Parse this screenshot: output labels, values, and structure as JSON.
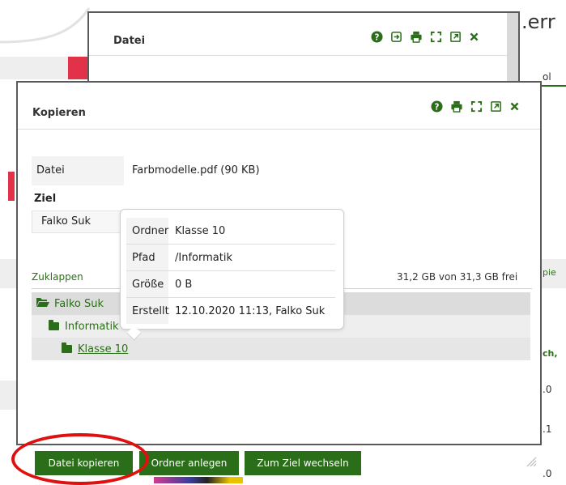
{
  "background": {
    "logo_fragment": ".err",
    "right_texts": [
      "ol",
      "pie",
      "ch,",
      ".0",
      ".1",
      ".0"
    ]
  },
  "back_dialog": {
    "title": "Datei",
    "icons": [
      "help-icon",
      "login-icon",
      "print-icon",
      "fullscreen-icon",
      "external-link-icon",
      "close-icon"
    ]
  },
  "copy_dialog": {
    "title": "Kopieren",
    "icons": [
      "help-icon",
      "print-icon",
      "fullscreen-icon",
      "external-link-icon",
      "close-icon"
    ],
    "file_label": "Datei",
    "file_value": "Farbmodelle.pdf (90 KB)",
    "target_label": "Ziel",
    "target_value": "Falko Suk",
    "collapse_link": "Zuklappen",
    "storage": "31,2 GB von 31,3 GB frei",
    "tree": [
      {
        "label": "Falko Suk"
      },
      {
        "label": "Informatik"
      },
      {
        "label": "Klasse 10"
      }
    ],
    "buttons": {
      "copy": "Datei kopieren",
      "new_folder": "Ordner anlegen",
      "goto_target": "Zum Ziel wechseln"
    }
  },
  "popover": {
    "rows": [
      {
        "key": "Ordner",
        "value": "Klasse 10"
      },
      {
        "key": "Pfad",
        "value": "/Informatik"
      },
      {
        "key": "Größe",
        "value": "0 B"
      },
      {
        "key": "Erstellt",
        "value": "12.10.2020 11:13, Falko Suk"
      }
    ]
  },
  "colors": {
    "accent_green": "#2b6e19",
    "annotation_red": "#e01010",
    "background_red": "#e1324a"
  }
}
